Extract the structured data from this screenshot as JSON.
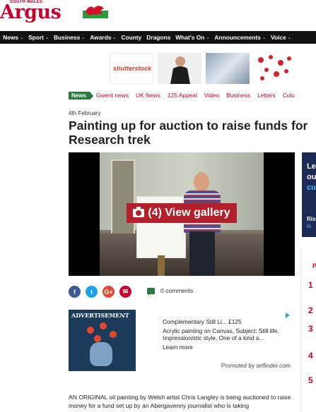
{
  "masthead": {
    "tagline": "SOUTH WALES",
    "logo": "Argus"
  },
  "nav": {
    "items": [
      {
        "label": "News",
        "chevron": true
      },
      {
        "label": "Sport",
        "chevron": true
      },
      {
        "label": "Business",
        "chevron": true
      },
      {
        "label": "Awards",
        "chevron": true
      },
      {
        "label": "County",
        "chevron": false
      },
      {
        "label": "Dragons",
        "chevron": false
      },
      {
        "label": "What's On",
        "chevron": true
      },
      {
        "label": "Announcements",
        "chevron": true
      },
      {
        "label": "Voice",
        "chevron": true
      }
    ]
  },
  "adstrip": {
    "brand": "shutterstock"
  },
  "categories": {
    "badge": "News",
    "links": [
      "Gwent news",
      "UK News",
      "125 Appeal",
      "Video",
      "Business",
      "Letters",
      "Colu"
    ]
  },
  "article": {
    "date": "4th February",
    "headline_line1": "Painting up for auction to raise funds for",
    "headline_line2": "Research trek",
    "gallery_label": "(4) View gallery",
    "comments": "0 comments",
    "body": "AN ORIGINAL oil painting by Welsh artist Chris Langley is being auctioned to raise money for a fund set up by an Abergavenny journalist who is taking"
  },
  "share": {
    "facebook": "f",
    "twitter": "t",
    "googleplus": "G+",
    "email": "✉"
  },
  "advert": {
    "tag": "ADVERTISEMENT",
    "title": "Complementary Still Li... £125",
    "description": "Acrylic painting on Canvas, Subject: Still life, Impressionistic style, One of a kind a...",
    "more": "Learn more",
    "promo": "Promoted by artfinder.com"
  },
  "rail": {
    "box_line1": "Le",
    "box_line2": "ou",
    "box_line3": "cu",
    "box_line4": "Ris",
    "box_line5": "lo",
    "list_header": "P",
    "numbers": [
      "1",
      "2",
      "3",
      "4",
      "5"
    ]
  }
}
